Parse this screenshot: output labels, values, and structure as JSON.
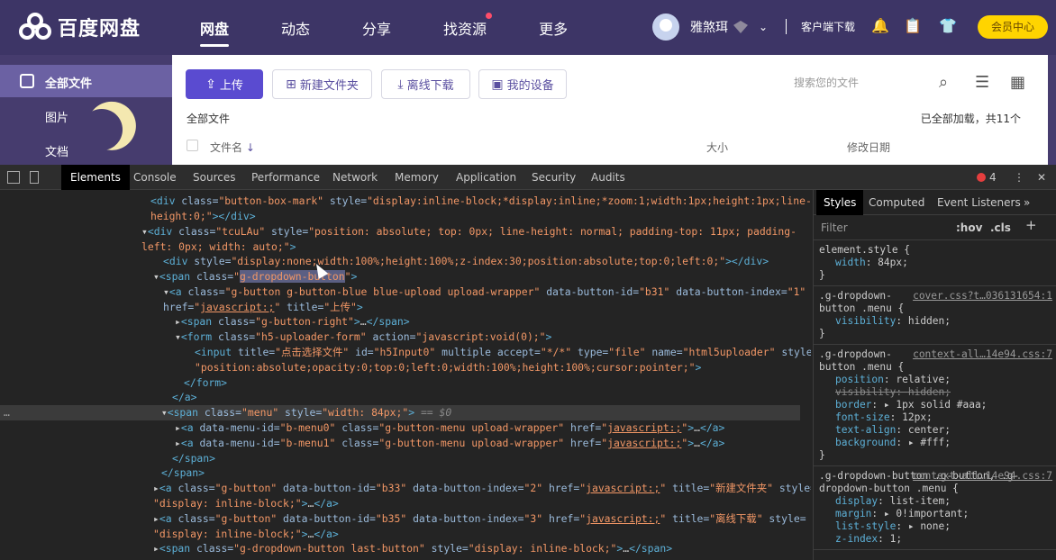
{
  "app": {
    "logo_text": "百度网盘",
    "nav": [
      {
        "label": "网盘",
        "active": true
      },
      {
        "label": "动态"
      },
      {
        "label": "分享"
      },
      {
        "label": "找资源",
        "dot": true
      },
      {
        "label": "更多"
      }
    ],
    "username": "雅煞珥",
    "client_download": "客户端下载",
    "member_center": "会员中心",
    "sidebar": [
      {
        "label": "全部文件",
        "active": true
      },
      {
        "label": "图片"
      },
      {
        "label": "文档"
      }
    ],
    "toolbar": {
      "upload": "上传",
      "new_folder": "新建文件夹",
      "offline_download": "离线下载",
      "my_devices": "我的设备",
      "search_placeholder": "搜索您的文件"
    },
    "breadcrumb": "全部文件",
    "loaded_status": "已全部加载，共11个",
    "columns": {
      "name": "文件名",
      "size": "大小",
      "modified": "修改日期"
    }
  },
  "devtools": {
    "tabs": [
      "Elements",
      "Console",
      "Sources",
      "Performance",
      "Network",
      "Memory",
      "Application",
      "Security",
      "Audits"
    ],
    "active_tab": "Elements",
    "error_count": "4",
    "dom_lines": [
      "<div class=\"button-box-mark\" style=\"display:inline-block;*display:inline;*zoom:1;width:1px;height:1px;line-",
      "height:0;\"></div>",
      "▾<div class=\"tcuLAu\" style=\"position: absolute; top: 0px; line-height: normal; padding-top: 11px; padding-",
      "left: 0px; width: auto;\">",
      "<div style=\"display:none;width:100%;height:100%;z-index:30;position:absolute;top:0;left:0;\"></div>",
      "▾<span class=\"g-dropdown-button\">",
      "▾<a class=\"g-button g-button-blue blue-upload upload-wrapper\" data-button-id=\"b31\" data-button-index=\"1\"",
      "href=\"javascript:;\" title=\"上传\">",
      "▸<span class=\"g-button-right\">…</span>",
      "▾<form class=\"h5-uploader-form\" action=\"javascript:void(0);\">",
      "<input title=\"点击选择文件\" id=\"h5Input0\" multiple accept=\"*/*\" type=\"file\" name=\"html5uploader\" style=",
      "\"position:absolute;opacity:0;top:0;left:0;width:100%;height:100%;cursor:pointer;\">",
      "</form>",
      "</a>",
      "▾<span class=\"menu\" style=\"width: 84px;\"> == $0",
      "▸<a data-menu-id=\"b-menu0\" class=\"g-button-menu  upload-wrapper\" href=\"javascript:;\">…</a>",
      "▸<a data-menu-id=\"b-menu1\" class=\"g-button-menu  upload-wrapper\" href=\"javascript:;\">…</a>",
      "</span>",
      "</span>",
      "▸<a class=\"g-button\" data-button-id=\"b33\" data-button-index=\"2\" href=\"javascript:;\" title=\"新建文件夹\" style=",
      "\"display: inline-block;\">…</a>",
      "▸<a class=\"g-button\" data-button-id=\"b35\" data-button-index=\"3\" href=\"javascript:;\" title=\"离线下载\" style=",
      "\"display: inline-block;\">…</a>",
      "▸<span class=\"g-dropdown-button last-button\" style=\"display: inline-block;\">…</span>"
    ],
    "styles_tabs": [
      "Styles",
      "Computed",
      "Event Listeners"
    ],
    "filter_placeholder": "Filter",
    "hov": ":hov",
    "cls": ".cls",
    "rules": [
      {
        "selector": "element.style {",
        "source": "",
        "props": [
          {
            "n": "width",
            "v": "84px;"
          }
        ]
      },
      {
        "selector": ".g-dropdown-button .menu {",
        "source": "cover.css?t…036131654:1",
        "props": [
          {
            "n": "visibility",
            "v": "hidden;"
          }
        ]
      },
      {
        "selector": ".g-dropdown-button .menu {",
        "source": "context-all…14e94.css:7",
        "props": [
          {
            "n": "position",
            "v": "relative;"
          },
          {
            "n": "visibility",
            "v": "hidden;",
            "strike": true
          },
          {
            "n": "border",
            "v": "▸ 1px solid #aaa;"
          },
          {
            "n": "font-size",
            "v": "12px;"
          },
          {
            "n": "text-align",
            "v": "center;"
          },
          {
            "n": "background",
            "v": "▸ #fff;"
          }
        ]
      },
      {
        "selector": ".g-dropdown-button .g-button, .g-dropdown-button .menu {",
        "source": "context-all…14e94.css:7",
        "props": [
          {
            "n": "display",
            "v": "list-item;"
          },
          {
            "n": "margin",
            "v": "▸ 0!important;"
          },
          {
            "n": "list-style",
            "v": "▸ none;"
          },
          {
            "n": "z-index",
            "v": "1;"
          }
        ]
      }
    ]
  }
}
